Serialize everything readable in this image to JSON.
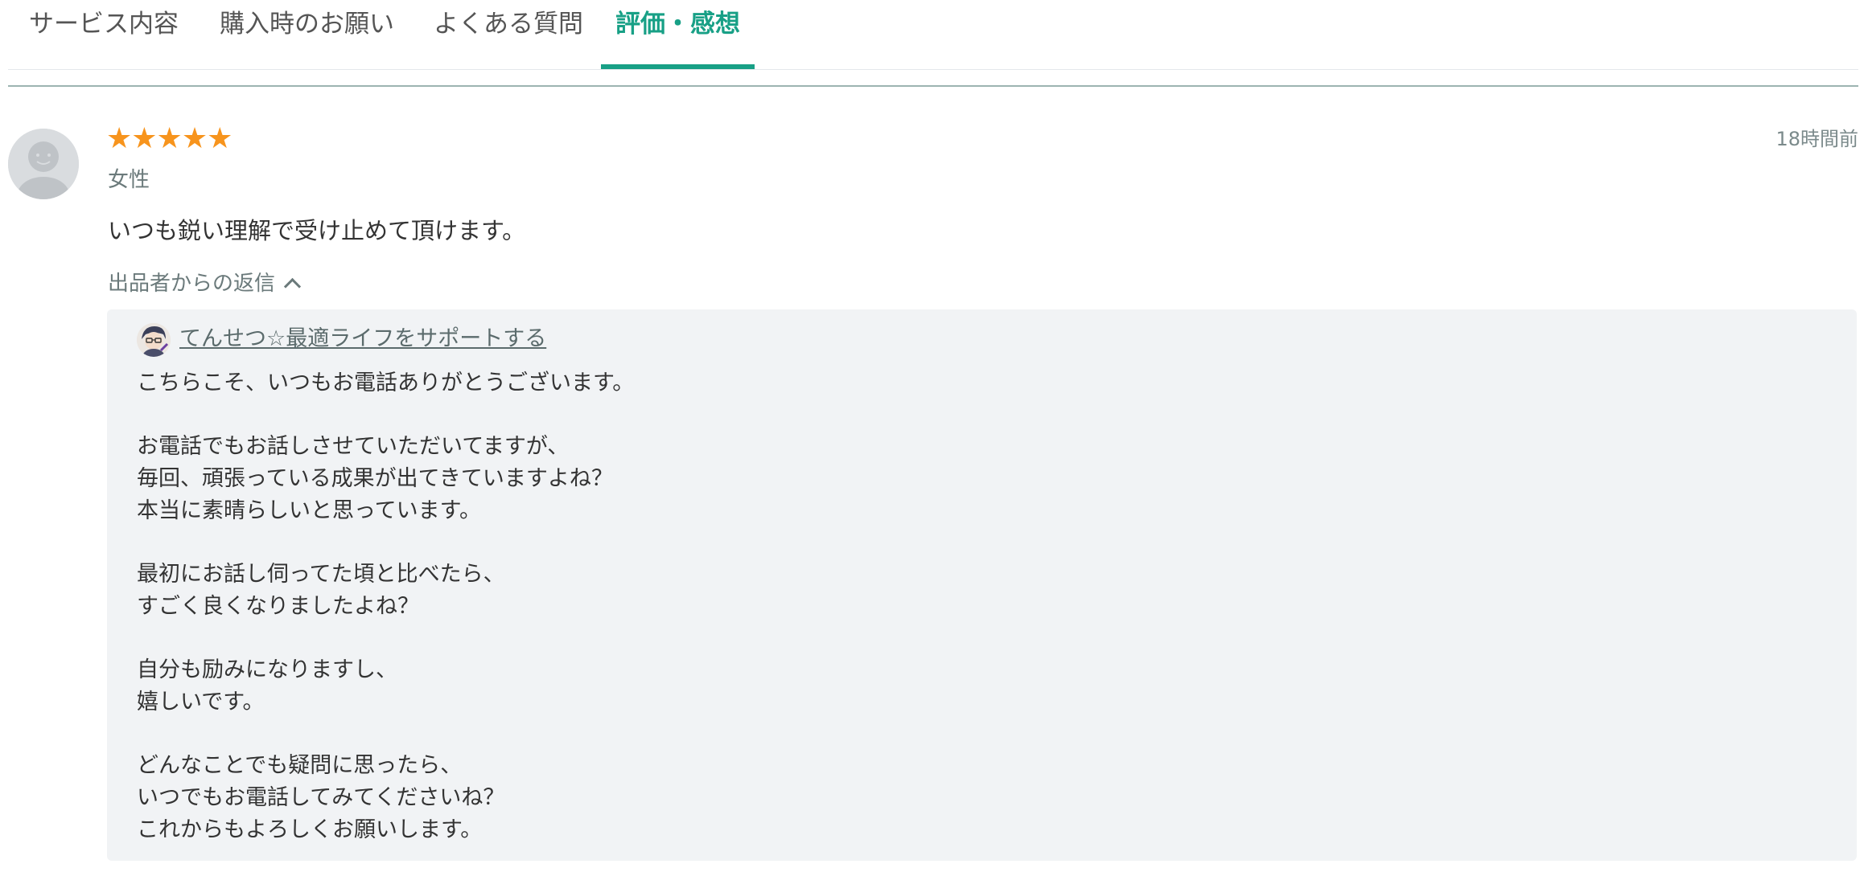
{
  "tabs": [
    {
      "label": "サービス内容"
    },
    {
      "label": "購入時のお願い"
    },
    {
      "label": "よくある質問"
    },
    {
      "label": "評価・感想"
    }
  ],
  "active_tab": "評価・感想",
  "colors": {
    "accent": "#18a086",
    "star": "#f7941d",
    "reply_bg": "#f1f3f5"
  },
  "review": {
    "rating": 5,
    "rating_max": 5,
    "stars_text": "★★★★★",
    "timestamp": "18時間前",
    "gender": "女性",
    "comment": "いつも鋭い理解で受け止めて頂けます。",
    "reply_toggle_label": "出品者からの返信",
    "reply": {
      "seller_name": "てんせつ☆最適ライフをサポートする",
      "lines": [
        "こちらこそ、いつもお電話ありがとうございます。",
        "",
        "お電話でもお話しさせていただいてますが、",
        "毎回、頑張っている成果が出てきていますよね？",
        "本当に素晴らしいと思っています。",
        "",
        "最初にお話し伺ってた頃と比べたら、",
        "すごく良くなりましたよね？",
        "",
        "自分も励みになりますし、",
        "嬉しいです。",
        "",
        "どんなことでも疑問に思ったら、",
        "いつでもお電話してみてくださいね？",
        "これからもよろしくお願いします。"
      ]
    }
  }
}
